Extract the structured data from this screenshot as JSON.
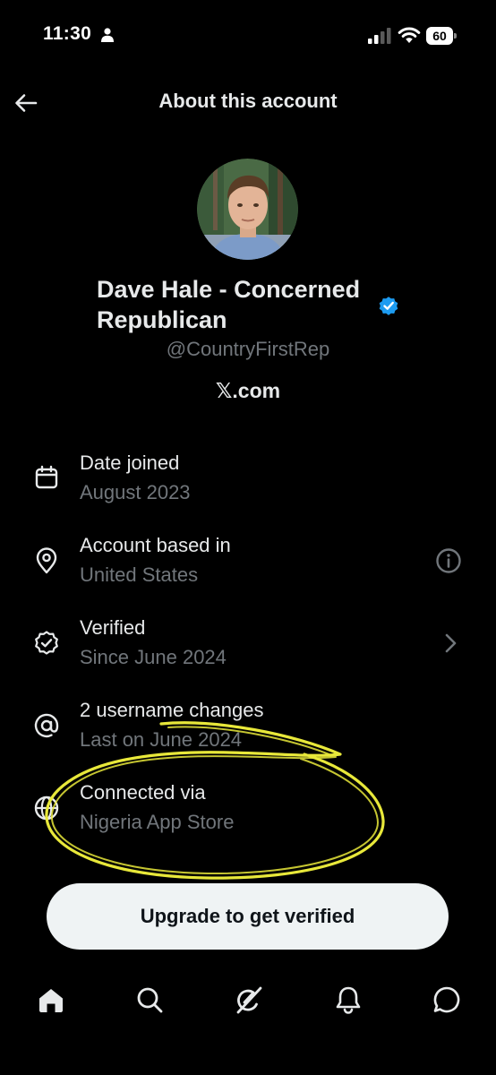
{
  "status_bar": {
    "time": "11:30",
    "battery": "60",
    "icons": [
      "person-icon",
      "cellular-signal-icon",
      "wifi-icon",
      "battery-icon"
    ]
  },
  "header": {
    "title": "About this account",
    "back_icon": "arrow-left-icon"
  },
  "profile": {
    "display_name": "Dave Hale - Concerned Republican",
    "handle": "@CountryFirstRep",
    "platform": "𝕏.com",
    "verified_badge_color": "#1d9bf0"
  },
  "info_rows": [
    {
      "icon": "calendar-icon",
      "title": "Date joined",
      "subtitle": "August 2023"
    },
    {
      "icon": "location-pin-icon",
      "title": "Account based in",
      "subtitle": "United States",
      "action_icon": "info-icon"
    },
    {
      "icon": "verified-outline-icon",
      "title": "Verified",
      "subtitle": "Since June 2024",
      "action_icon": "chevron-right-icon"
    },
    {
      "icon": "at-sign-icon",
      "title": "2 username changes",
      "subtitle": "Last on June 2024"
    },
    {
      "icon": "globe-icon",
      "title": "Connected via",
      "subtitle": "Nigeria App Store"
    }
  ],
  "annotation": {
    "color": "#e8e83a"
  },
  "upgrade_button": {
    "label": "Upgrade to get verified"
  },
  "bottom_nav": [
    "home-icon",
    "search-icon",
    "grok-icon",
    "notifications-bell-icon",
    "messages-icon"
  ],
  "colors": {
    "background": "#000000",
    "primary_text": "#e7e9ea",
    "secondary_text": "#71767b",
    "button_bg": "#eff3f4"
  }
}
